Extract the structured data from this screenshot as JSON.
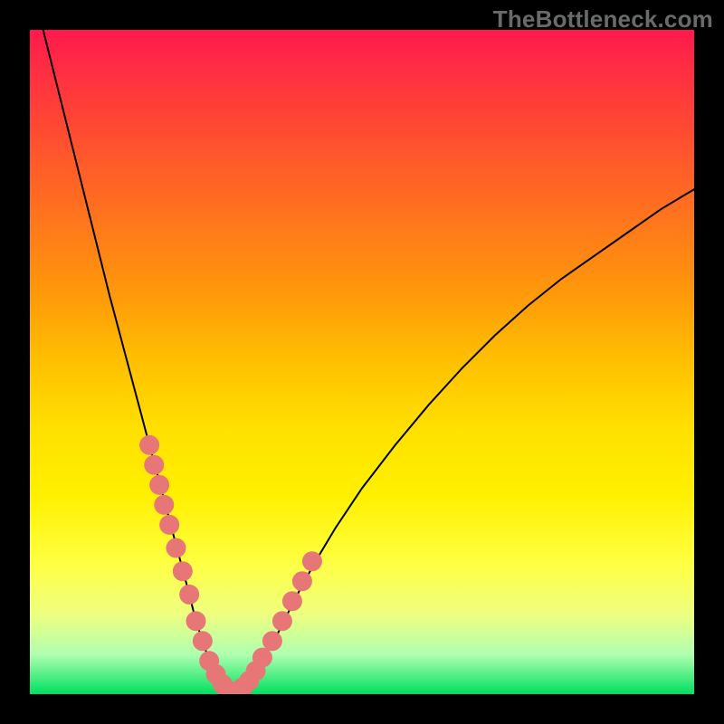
{
  "watermark": {
    "text": "TheBottleneck.com"
  },
  "chart_data": {
    "type": "line",
    "title": "",
    "xlabel": "",
    "ylabel": "",
    "xlim": [
      0,
      100
    ],
    "ylim": [
      0,
      100
    ],
    "grid": false,
    "legend": false,
    "series": [
      {
        "name": "curve",
        "x": [
          2,
          4,
          6,
          8,
          10,
          12,
          14,
          16,
          18,
          19,
          20,
          21,
          22,
          23,
          24,
          25,
          27,
          28,
          29,
          30,
          31,
          32,
          33,
          35,
          37,
          40,
          43,
          46,
          50,
          55,
          60,
          65,
          70,
          75,
          80,
          85,
          90,
          95,
          100
        ],
        "y": [
          100,
          92,
          84,
          76,
          68,
          60,
          52.5,
          45,
          37.5,
          33.8,
          30,
          26.3,
          22.5,
          18.8,
          15,
          11,
          5,
          3,
          1.5,
          0.5,
          0.3,
          1,
          2,
          5,
          8.5,
          14.5,
          20,
          25,
          31,
          37.5,
          43.5,
          49,
          54,
          58.5,
          62.5,
          66,
          69.5,
          73,
          76
        ]
      }
    ],
    "markers": {
      "name": "dots",
      "x": [
        18.0,
        18.7,
        19.5,
        20.2,
        21.0,
        22.0,
        23.0,
        24.0,
        25.0,
        26.0,
        27.0,
        28.0,
        29.0,
        30.0,
        31.0,
        32.0,
        33.0,
        34.0,
        35.0,
        36.5,
        38.0,
        39.5,
        41.0,
        42.5
      ],
      "y": [
        37.5,
        34.5,
        31.5,
        28.5,
        25.5,
        22.0,
        18.5,
        15.0,
        11.0,
        8.0,
        5.0,
        3.0,
        1.5,
        0.5,
        0.3,
        1.0,
        2.0,
        3.5,
        5.5,
        8.0,
        11.0,
        14.0,
        17.0,
        20.0
      ]
    },
    "marker_style": {
      "color": "#e77777",
      "radius_px": 11
    }
  }
}
